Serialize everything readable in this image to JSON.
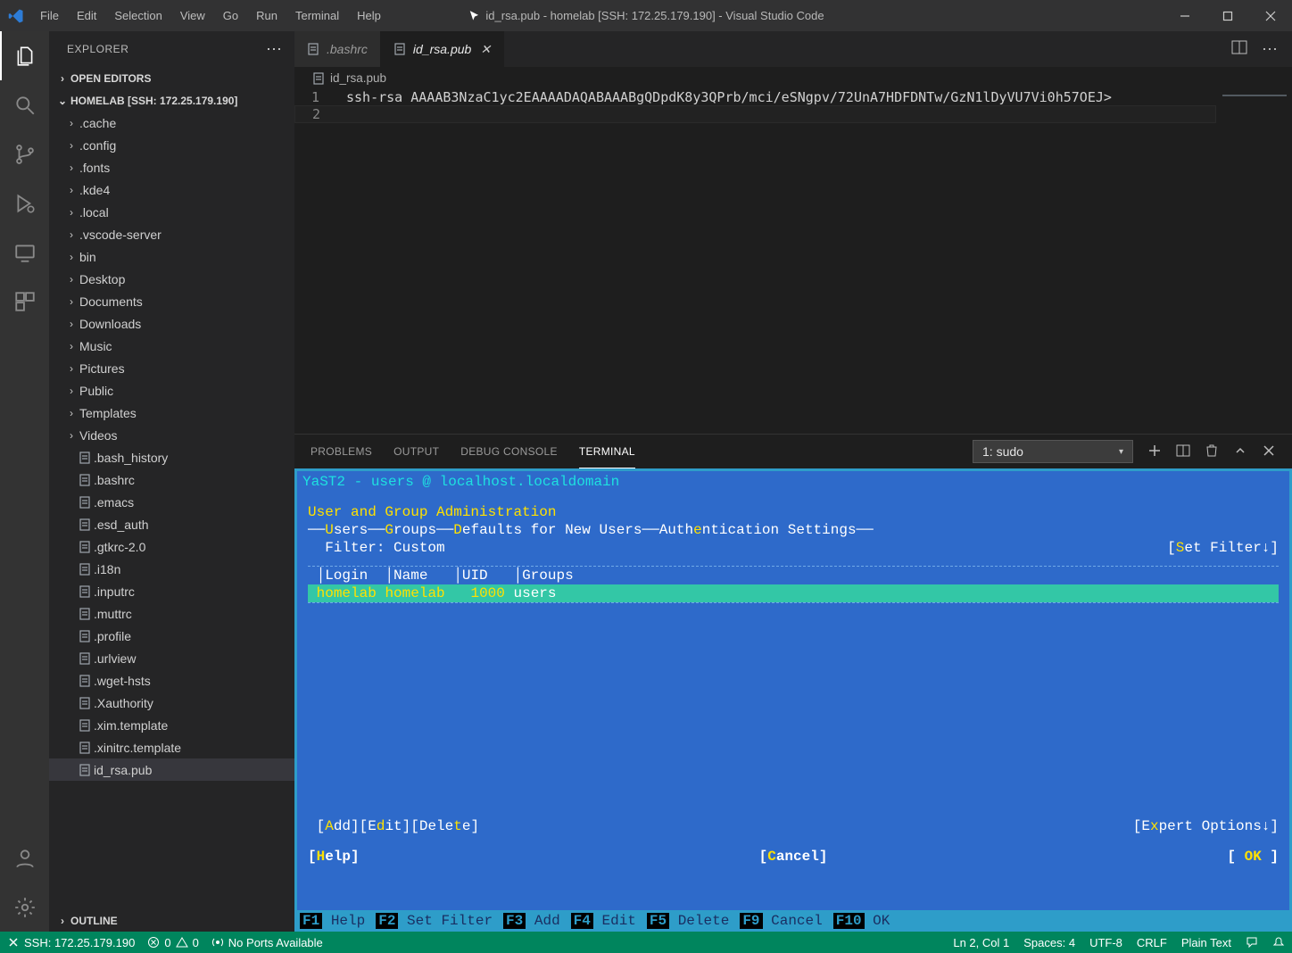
{
  "titlebar": {
    "title": "id_rsa.pub - homelab [SSH: 172.25.179.190] - Visual Studio Code",
    "menus": [
      "File",
      "Edit",
      "Selection",
      "View",
      "Go",
      "Run",
      "Terminal",
      "Help"
    ]
  },
  "sidebar": {
    "header": "EXPLORER",
    "sections": {
      "open_editors": "OPEN EDITORS",
      "workspace": "HOMELAB [SSH: 172.25.179.190]",
      "outline": "OUTLINE"
    },
    "folders": [
      ".cache",
      ".config",
      ".fonts",
      ".kde4",
      ".local",
      ".vscode-server",
      "bin",
      "Desktop",
      "Documents",
      "Downloads",
      "Music",
      "Pictures",
      "Public",
      "Templates",
      "Videos"
    ],
    "files": [
      ".bash_history",
      ".bashrc",
      ".emacs",
      ".esd_auth",
      ".gtkrc-2.0",
      ".i18n",
      ".inputrc",
      ".muttrc",
      ".profile",
      ".urlview",
      ".wget-hsts",
      ".Xauthority",
      ".xim.template",
      ".xinitrc.template",
      "id_rsa.pub"
    ],
    "selected_file": "id_rsa.pub"
  },
  "tabs": [
    {
      "name": ".bashrc",
      "active": false
    },
    {
      "name": "id_rsa.pub",
      "active": true
    }
  ],
  "breadcrumb": "id_rsa.pub",
  "editor": {
    "lines": [
      {
        "num": "1",
        "text": "ssh-rsa AAAAB3NzaC1yc2EAAAADAQABAAABgQDpdK8y3QPrb/mci/eSNgpv/72UnA7HDFDNTw/GzN1lDyVU7Vi0h57OEJ>"
      },
      {
        "num": "2",
        "text": ""
      }
    ]
  },
  "panel": {
    "tabs": [
      "PROBLEMS",
      "OUTPUT",
      "DEBUG CONSOLE",
      "TERMINAL"
    ],
    "active_tab": "TERMINAL",
    "terminal_select": "1: sudo"
  },
  "yast": {
    "title": "YaST2 - users @ localhost.localdomain",
    "section_header": "User and Group Administration",
    "tabs_raw": "──Users──Groups──Defaults for New Users──Authentication Settings──",
    "tabs_hk": {
      "u": "U",
      "g": "G",
      "d": "D",
      "e": "e"
    },
    "filter_label": "Filter: Custom",
    "set_filter": "Set Filter",
    "columns": {
      "login": "Login",
      "name": "Name",
      "uid": "UID",
      "groups": "Groups"
    },
    "row": {
      "login": "homelab",
      "name": "homelab",
      "uid": "1000",
      "groups": "users"
    },
    "actions": {
      "add": "Add",
      "edit": "Edit",
      "delete": "Delete"
    },
    "expert": "Expert Options",
    "help": "Help",
    "cancel": "Cancel",
    "ok": "OK",
    "fkeys": [
      {
        "key": "F1",
        "label": "Help"
      },
      {
        "key": "F2",
        "label": "Set Filter"
      },
      {
        "key": "F3",
        "label": "Add"
      },
      {
        "key": "F4",
        "label": "Edit"
      },
      {
        "key": "F5",
        "label": "Delete"
      },
      {
        "key": "F9",
        "label": "Cancel"
      },
      {
        "key": "F10",
        "label": "OK"
      }
    ]
  },
  "statusbar": {
    "remote": "SSH: 172.25.179.190",
    "problems": {
      "errors": "0",
      "warnings": "0"
    },
    "ports": "No Ports Available",
    "cursor": "Ln 2, Col 1",
    "spaces": "Spaces: 4",
    "encoding": "UTF-8",
    "eol": "CRLF",
    "lang": "Plain Text"
  }
}
